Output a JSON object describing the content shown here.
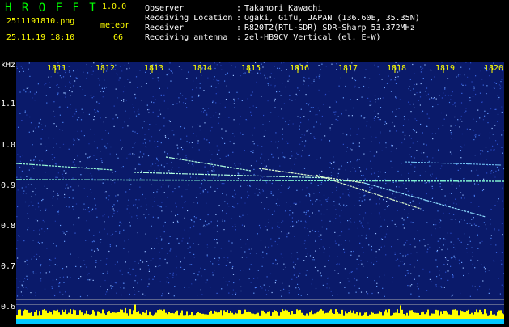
{
  "header": {
    "app_title": "H R O F F T",
    "version": "1.0.0",
    "filename": "2511191810.png",
    "timestamp": "25.11.19 18:10",
    "meteor_label": "meteor",
    "meteor_count": "66"
  },
  "station": {
    "observer_label": "Observer",
    "observer_value": "Takanori Kawachi",
    "location_label": "Receiving Location",
    "location_value": "Ogaki, Gifu, JAPAN (136.60E, 35.35N)",
    "receiver_label": "Receiver",
    "receiver_value": "R820T2(RTL-SDR) SDR-Sharp 53.372MHz",
    "antenna_label": "Receiving antenna",
    "antenna_value": "2el-HB9CV Vertical (el. E-W)",
    "colon": ":"
  },
  "axis": {
    "unit": "kHz",
    "y_ticks": [
      "1.1",
      "1.0",
      "0.9",
      "0.8",
      "0.7",
      "0.6"
    ],
    "x_ticks": [
      "1811",
      "1812",
      "1813",
      "1814",
      "1815",
      "1816",
      "1817",
      "1818",
      "1819",
      "1820"
    ]
  },
  "colors": {
    "title": "#00ff00",
    "yellow": "#ffff00",
    "background": "#0a1a6a",
    "trace": "#ff3030"
  }
}
